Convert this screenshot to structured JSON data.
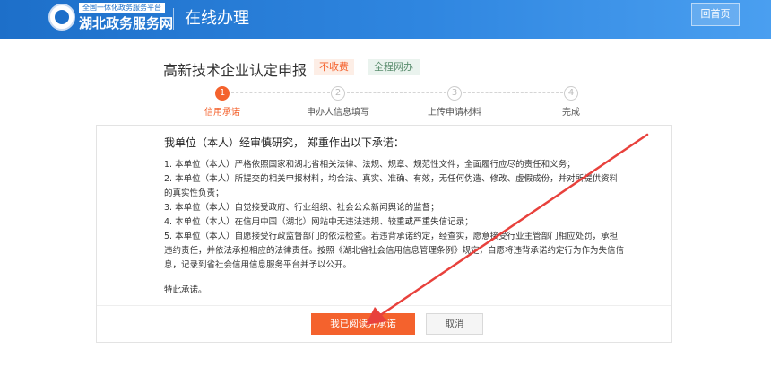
{
  "header": {
    "platform_sub": "全国一体化政务服务平台",
    "site_name": "湖北政务服务网",
    "section_title": "在线办理",
    "back_button": "回首页",
    "logo_icon": "emblem-icon"
  },
  "main": {
    "title": "高新技术企业认定申报",
    "tags": [
      "不收费",
      "全程网办"
    ]
  },
  "steps": [
    {
      "number": "1",
      "label": "信用承诺",
      "state": "active"
    },
    {
      "number": "2",
      "label": "申办人信息填写",
      "state": "todo"
    },
    {
      "number": "3",
      "label": "上传申请材料",
      "state": "todo"
    },
    {
      "number": "4",
      "label": "完成",
      "state": "todo"
    }
  ],
  "pledge": {
    "heading": "我单位（本人）经审慎研究，  郑重作出以下承诺：",
    "items": [
      "1. 本单位（本人）严格依照国家和湖北省相关法律、法规、规章、规范性文件，全面履行应尽的责任和义务；",
      "2. 本单位（本人）所提交的相关申报材料，均合法、真实、准确、有效，无任何伪造、修改、虚假成份，并对所提供资料的真实性负责；",
      "3. 本单位（本人）自觉接受政府、行业组织、社会公众新闻舆论的监督；",
      "4. 本单位（本人）在信用中国（湖北）网站中无违法违规、较重或严重失信记录；",
      "5. 本单位（本人）自愿接受行政监督部门的依法检查。若违背承诺约定，经查实，愿意接受行业主管部门相应处罚，承担违约责任，并依法承担相应的法律责任。按照《湖北省社会信用信息管理条例》规定，自愿将违背承诺约定行为作为失信信息，记录到省社会信用信息服务平台并予以公开。"
    ],
    "closing": "特此承诺。"
  },
  "buttons": {
    "agree": "我已阅读并承诺",
    "cancel": "取消"
  },
  "colors": {
    "header_blue": "#1d6fc9",
    "accent_orange": "#f4622d",
    "annotation_red": "#e8413c"
  }
}
